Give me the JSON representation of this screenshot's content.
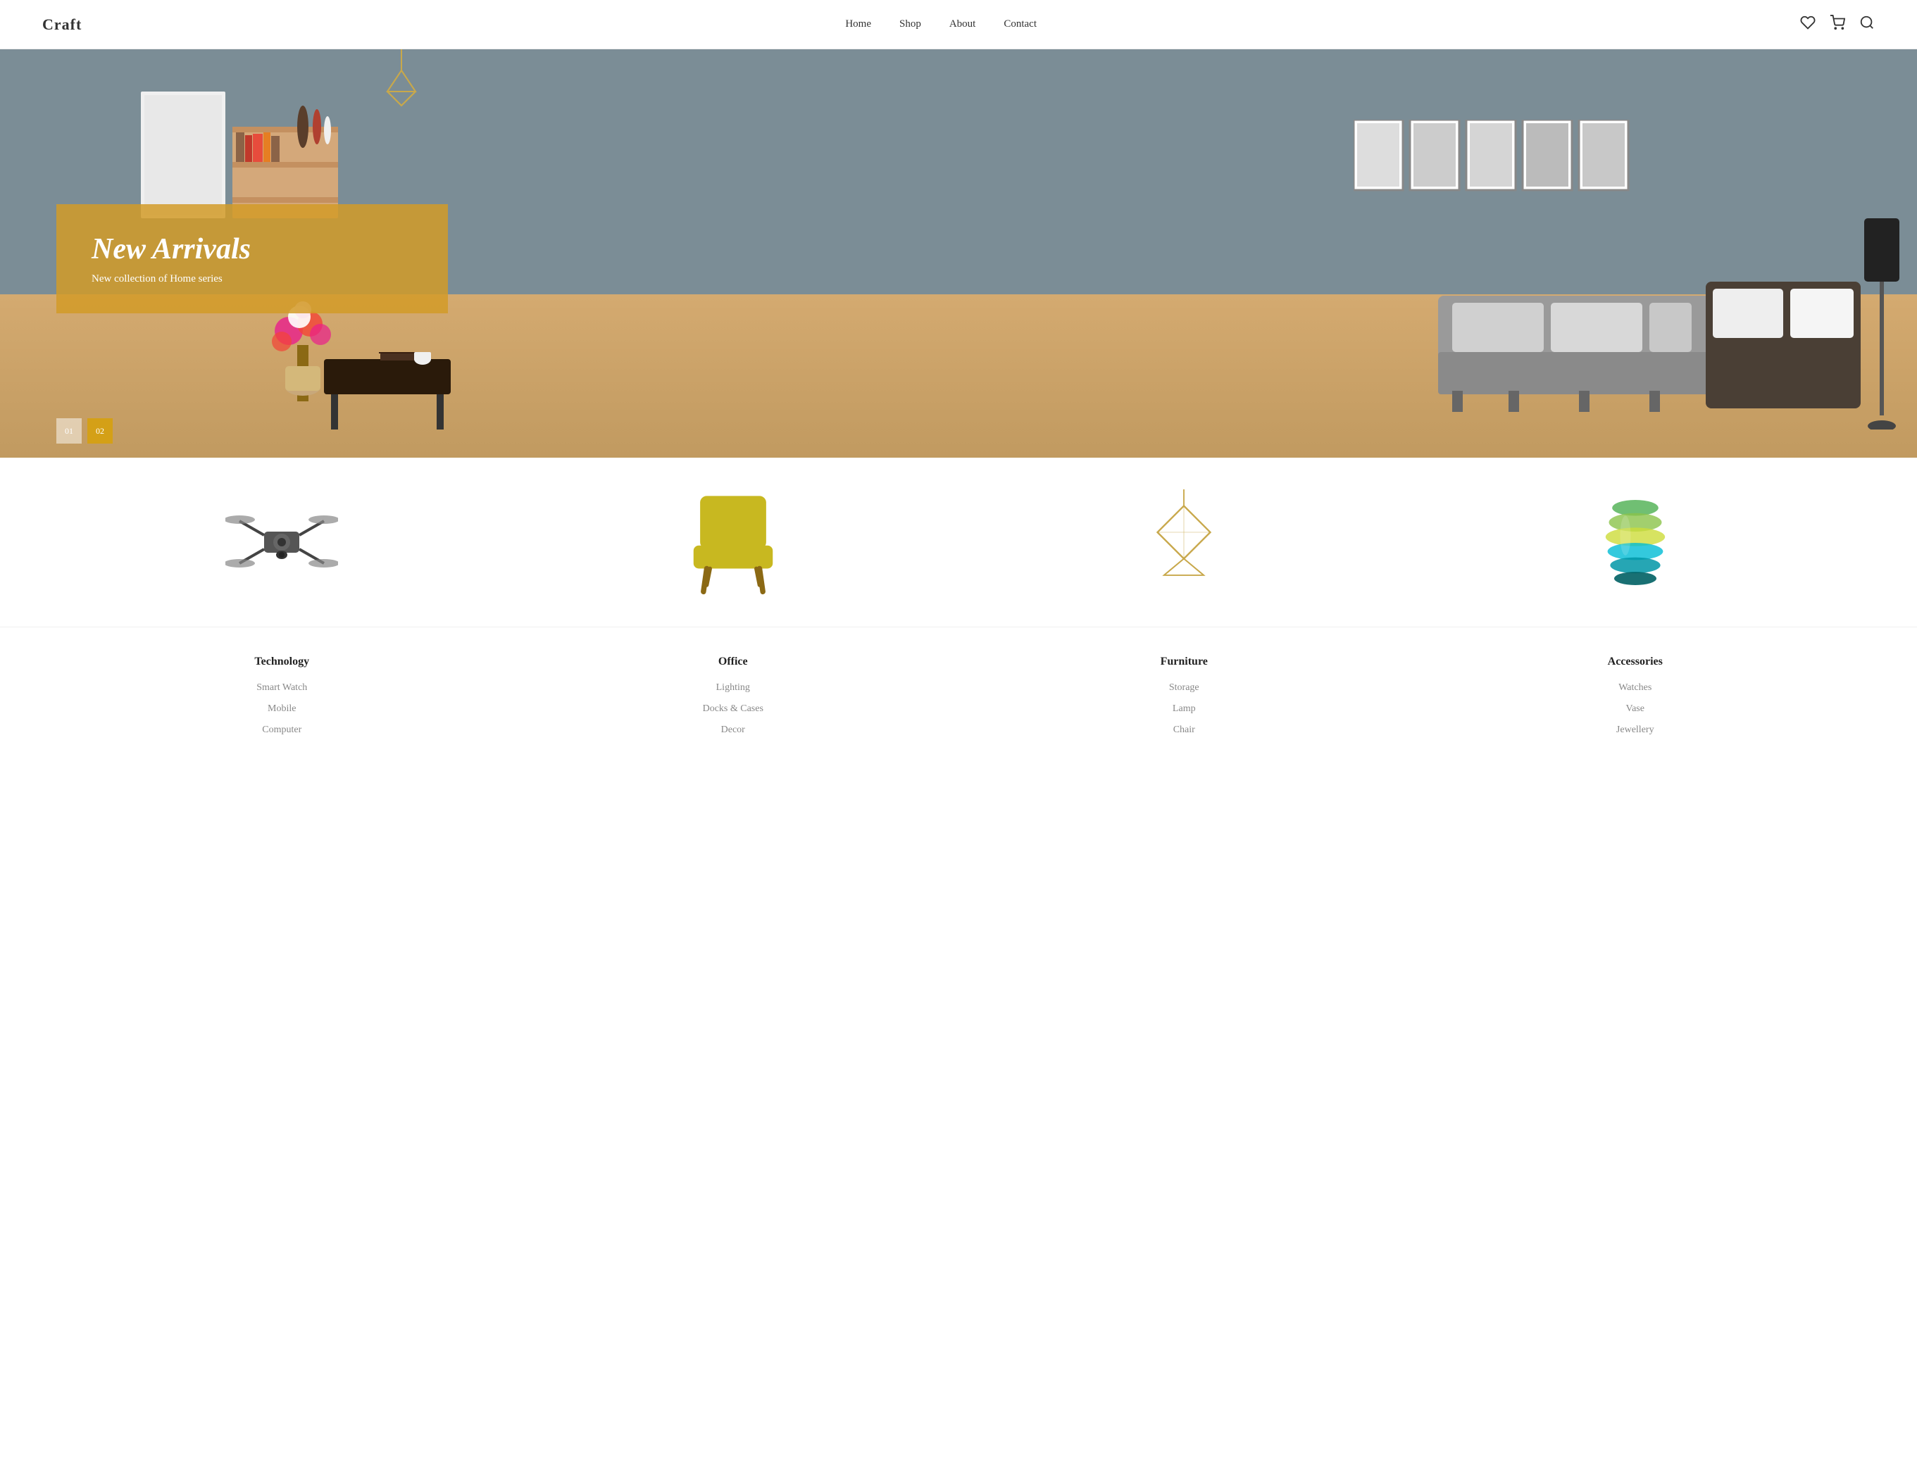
{
  "header": {
    "logo": "Craft",
    "nav": [
      {
        "label": "Home",
        "href": "#"
      },
      {
        "label": "Shop",
        "href": "#"
      },
      {
        "label": "About",
        "href": "#"
      },
      {
        "label": "Contact",
        "href": "#"
      }
    ]
  },
  "hero": {
    "title": "New Arrivals",
    "subtitle": "New collection of Home series",
    "slides": [
      "01",
      "02"
    ]
  },
  "categories": [
    {
      "title": "Technology",
      "items": [
        "Smart Watch",
        "Mobile",
        "Computer"
      ]
    },
    {
      "title": "Office",
      "items": [
        "Lighting",
        "Docks & Cases",
        "Decor"
      ]
    },
    {
      "title": "Furniture",
      "items": [
        "Storage",
        "Lamp",
        "Chair"
      ]
    },
    {
      "title": "Accessories",
      "items": [
        "Watches",
        "Vase",
        "Jewellery"
      ]
    }
  ]
}
